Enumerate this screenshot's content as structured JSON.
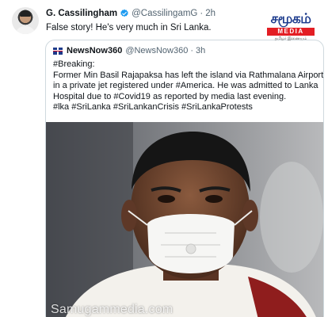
{
  "tweet": {
    "author_name": "G. Cassilingham",
    "handle": "@CassilingamG",
    "separator": "·",
    "time": "2h",
    "text": "False story! He's very much in Sri Lanka."
  },
  "quoted_tweet": {
    "author_name": "NewsNow360",
    "handle": "@NewsNow360",
    "separator": "·",
    "time": "3h",
    "lines": [
      "#Breaking:",
      "Former Min Basil Rajapaksa has left the island via Rathmalana Airport,",
      "in a private jet registered under #America. He was admitted to Lanka",
      "Hospital due to #Covid19 as reported by media last evening.",
      "#lka #SriLanka #SriLankanCrisis #SriLankaProtests"
    ],
    "image_watermark": "Samugammedia.com"
  },
  "brand": {
    "name": "சமூகம்",
    "tag": "MEDIA",
    "subtitle": "தமிழர் இணையம்"
  },
  "colors": {
    "verified": "#1d9bf0",
    "secondary_text": "#536471",
    "brand_blue": "#1b3a8c",
    "brand_red": "#e31e24"
  },
  "icons": {
    "verified": "verified-badge-icon",
    "flag": "uk-flag-icon"
  }
}
